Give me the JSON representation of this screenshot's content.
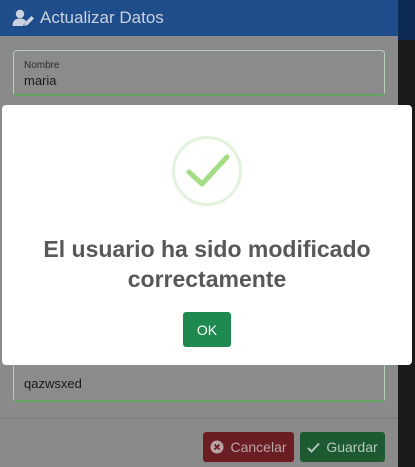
{
  "modal": {
    "title": "Actualizar Datos",
    "fields": [
      {
        "label": "Nombre",
        "value": "maria"
      },
      {
        "label": "",
        "value": "qazwsxed"
      }
    ],
    "buttons": {
      "cancel_label": "Cancelar",
      "save_label": "Guardar"
    }
  },
  "alert": {
    "message": "El usuario ha sido modificado correctamente",
    "ok_label": "OK",
    "icon": "success-check-icon"
  },
  "colors": {
    "header": "#1f4d8c",
    "success": "#1f8a50",
    "danger": "#6b1d24",
    "check": "#a5dc86"
  }
}
